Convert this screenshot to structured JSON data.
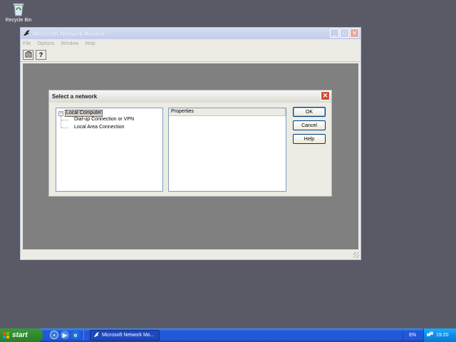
{
  "desktop": {
    "recycle_bin_label": "Recycle Bin"
  },
  "app_window": {
    "title": "Microsoft Network Monitor",
    "menu": [
      "File",
      "Options",
      "Window",
      "Help"
    ],
    "toolbar": {
      "help_label": "?"
    }
  },
  "dialog": {
    "title": "Select a network",
    "tree": {
      "expander": "−",
      "root": "Local Computer",
      "children": [
        "Dial-up Connection or VPN",
        "Local Area Connection"
      ]
    },
    "properties_header": "Properties",
    "buttons": {
      "ok": "OK",
      "cancel": "Cancel",
      "help": "Help"
    }
  },
  "taskbar": {
    "start_label": "start",
    "task_label": "Microsoft Network Mo...",
    "language": "EN",
    "clock": "19:20"
  },
  "colors": {
    "desktop": "#5a5a66",
    "taskbar": "#2358d8",
    "start_button": "#2f8a2f",
    "dialog_close": "#d84a2f"
  }
}
